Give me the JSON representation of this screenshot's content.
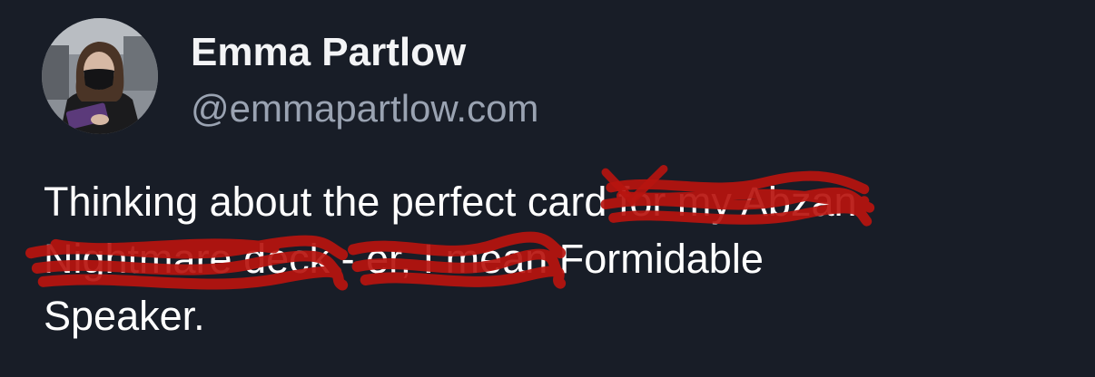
{
  "author": {
    "display_name": "Emma Partlow",
    "handle": "@emmapartlow.com",
    "avatar_icon": "person-with-mask-photo"
  },
  "post": {
    "line1_start": "Thinking about the perfect card ",
    "line1_redacted": "for my Abzan",
    "line2_redacted": "Nightmare deck",
    "line2_dash": " - ",
    "line2_redacted_b": "er, I mean",
    "line2_end": " Formidable",
    "line3": "Speaker."
  },
  "colors": {
    "background": "#181d27",
    "scribble": "#b8140f",
    "name": "#f3f4f6",
    "handle": "#9aa3b2"
  }
}
